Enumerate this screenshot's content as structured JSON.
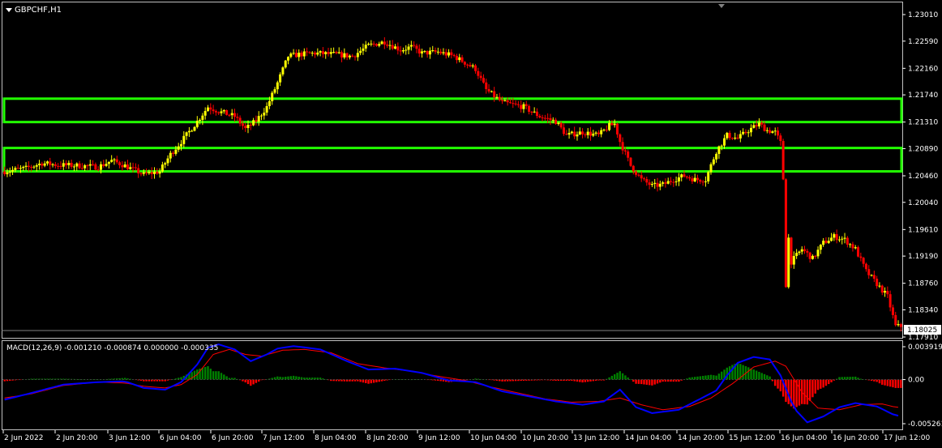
{
  "window": {
    "symbol_title": "GBPCHF,H1",
    "macd_title": "MACD(12,26,9) -0.001210 -0.000874 0.000000 -0.000335"
  },
  "colors": {
    "background": "#000000",
    "axis": "#ffffff",
    "bull_candle": "#ffff00",
    "bear_candle": "#ff0000",
    "zone_border": "#22ff00",
    "macd_line": "#0000ff",
    "signal_line": "#ff0000",
    "hist_positive": "#008000",
    "hist_negative": "#ff0000",
    "price_tag_bg": "#ffffff",
    "price_tag_text": "#000000"
  },
  "chart_data": [
    {
      "type": "candlestick",
      "symbol": "GBPCHF",
      "timeframe": "H1",
      "ylim": [
        1.1791,
        1.2301
      ],
      "y_ticks": [
        "1.23010",
        "1.22590",
        "1.22160",
        "1.21740",
        "1.21310",
        "1.20890",
        "1.20460",
        "1.20040",
        "1.19610",
        "1.19190",
        "1.18760",
        "1.18340",
        "1.17910"
      ],
      "x_ticks": [
        "2 Jun 2022",
        "2 Jun 20:00",
        "3 Jun 12:00",
        "6 Jun 04:00",
        "6 Jun 20:00",
        "7 Jun 12:00",
        "8 Jun 04:00",
        "8 Jun 20:00",
        "9 Jun 12:00",
        "10 Jun 04:00",
        "10 Jun 20:00",
        "13 Jun 12:00",
        "14 Jun 04:00",
        "14 Jun 20:00",
        "15 Jun 12:00",
        "16 Jun 04:00",
        "16 Jun 20:00",
        "17 Jun 12:00"
      ],
      "current_price": "1.18025",
      "zones": [
        {
          "top": 1.2168,
          "bottom": 1.2131
        },
        {
          "top": 1.209,
          "bottom": 1.2053
        }
      ],
      "path": [
        [
          0,
          1.2053
        ],
        [
          8,
          1.2058
        ],
        [
          14,
          1.2066
        ],
        [
          20,
          1.2063
        ],
        [
          28,
          1.2062
        ],
        [
          35,
          1.206
        ],
        [
          40,
          1.207
        ],
        [
          45,
          1.2062
        ],
        [
          52,
          1.2048
        ],
        [
          58,
          1.2053
        ],
        [
          62,
          1.208
        ],
        [
          66,
          1.21
        ],
        [
          72,
          1.2132
        ],
        [
          76,
          1.2155
        ],
        [
          80,
          1.2148
        ],
        [
          86,
          1.214
        ],
        [
          90,
          1.212
        ],
        [
          94,
          1.2133
        ],
        [
          98,
          1.2155
        ],
        [
          102,
          1.2193
        ],
        [
          106,
          1.2235
        ],
        [
          110,
          1.2238
        ],
        [
          116,
          1.224
        ],
        [
          124,
          1.2238
        ],
        [
          130,
          1.2235
        ],
        [
          136,
          1.2252
        ],
        [
          142,
          1.2258
        ],
        [
          148,
          1.2245
        ],
        [
          152,
          1.225
        ],
        [
          156,
          1.224
        ],
        [
          162,
          1.2242
        ],
        [
          168,
          1.2235
        ],
        [
          172,
          1.2225
        ],
        [
          176,
          1.2215
        ],
        [
          180,
          1.2182
        ],
        [
          186,
          1.2162
        ],
        [
          194,
          1.2155
        ],
        [
          200,
          1.214
        ],
        [
          206,
          1.2132
        ],
        [
          210,
          1.211
        ],
        [
          216,
          1.2115
        ],
        [
          222,
          1.211
        ],
        [
          226,
          1.2125
        ],
        [
          228,
          1.2128
        ],
        [
          230,
          1.21
        ],
        [
          234,
          1.2062
        ],
        [
          238,
          1.204
        ],
        [
          242,
          1.203
        ],
        [
          246,
          1.2032
        ],
        [
          250,
          1.204
        ],
        [
          254,
          1.2046
        ],
        [
          258,
          1.204
        ],
        [
          262,
          1.204
        ],
        [
          266,
          1.2085
        ],
        [
          270,
          1.211
        ],
        [
          274,
          1.2105
        ],
        [
          278,
          1.2118
        ],
        [
          282,
          1.2128
        ],
        [
          285,
          1.2118
        ],
        [
          288,
          1.2115
        ],
        [
          290,
          1.2098
        ],
        [
          292,
          1.1985
        ],
        [
          294,
          1.191
        ],
        [
          298,
          1.193
        ],
        [
          302,
          1.1915
        ],
        [
          306,
          1.194
        ],
        [
          310,
          1.195
        ],
        [
          314,
          1.1945
        ],
        [
          318,
          1.193
        ],
        [
          322,
          1.1895
        ],
        [
          326,
          1.1875
        ],
        [
          330,
          1.1855
        ],
        [
          333,
          1.1808
        ]
      ]
    },
    {
      "type": "macd",
      "params": "12,26,9",
      "ylim": [
        -0.005261,
        0.003919
      ],
      "y_ticks": [
        "0.003919",
        "0.00",
        "-0.005261"
      ],
      "macd_path": [
        [
          0,
          -0.0024
        ],
        [
          10,
          -0.0016
        ],
        [
          22,
          -0.0006
        ],
        [
          35,
          -0.0003
        ],
        [
          45,
          -0.0002
        ],
        [
          52,
          -0.001
        ],
        [
          60,
          -0.0012
        ],
        [
          66,
          -0.0003
        ],
        [
          72,
          0.0018
        ],
        [
          76,
          0.0038
        ],
        [
          80,
          0.0042
        ],
        [
          86,
          0.0036
        ],
        [
          92,
          0.0022
        ],
        [
          98,
          0.003
        ],
        [
          102,
          0.0037
        ],
        [
          108,
          0.004
        ],
        [
          118,
          0.0036
        ],
        [
          128,
          0.0022
        ],
        [
          136,
          0.0012
        ],
        [
          146,
          0.0013
        ],
        [
          156,
          0.0008
        ],
        [
          166,
          -0.0001
        ],
        [
          176,
          -0.0003
        ],
        [
          186,
          -0.0014
        ],
        [
          196,
          -0.002
        ],
        [
          206,
          -0.0026
        ],
        [
          216,
          -0.003
        ],
        [
          224,
          -0.0026
        ],
        [
          230,
          -0.0012
        ],
        [
          236,
          -0.0033
        ],
        [
          242,
          -0.004
        ],
        [
          252,
          -0.0036
        ],
        [
          260,
          -0.0023
        ],
        [
          266,
          -0.0013
        ],
        [
          270,
          0.0005
        ],
        [
          274,
          0.002
        ],
        [
          280,
          0.0027
        ],
        [
          286,
          0.0024
        ],
        [
          290,
          0.0005
        ],
        [
          295,
          -0.0034
        ],
        [
          300,
          -0.0051
        ],
        [
          306,
          -0.0044
        ],
        [
          312,
          -0.0033
        ],
        [
          318,
          -0.0028
        ],
        [
          326,
          -0.0032
        ],
        [
          333,
          -0.0043
        ]
      ],
      "signal_path": [
        [
          0,
          -0.0022
        ],
        [
          10,
          -0.0017
        ],
        [
          22,
          -0.0007
        ],
        [
          35,
          -0.0003
        ],
        [
          45,
          -0.0004
        ],
        [
          52,
          -0.0008
        ],
        [
          60,
          -0.001
        ],
        [
          66,
          -0.0006
        ],
        [
          72,
          0.0006
        ],
        [
          78,
          0.003
        ],
        [
          84,
          0.0036
        ],
        [
          90,
          0.003
        ],
        [
          96,
          0.0028
        ],
        [
          104,
          0.0035
        ],
        [
          112,
          0.0036
        ],
        [
          122,
          0.0032
        ],
        [
          132,
          0.0019
        ],
        [
          142,
          0.0014
        ],
        [
          152,
          0.001
        ],
        [
          162,
          0.0004
        ],
        [
          172,
          -0.0001
        ],
        [
          182,
          -0.0009
        ],
        [
          192,
          -0.0016
        ],
        [
          202,
          -0.0023
        ],
        [
          212,
          -0.0027
        ],
        [
          222,
          -0.0026
        ],
        [
          230,
          -0.0022
        ],
        [
          238,
          -0.003
        ],
        [
          246,
          -0.0036
        ],
        [
          256,
          -0.0032
        ],
        [
          264,
          -0.0022
        ],
        [
          272,
          -0.0005
        ],
        [
          280,
          0.0015
        ],
        [
          288,
          0.0022
        ],
        [
          292,
          0.0016
        ],
        [
          298,
          -0.0015
        ],
        [
          304,
          -0.0034
        ],
        [
          312,
          -0.0036
        ],
        [
          320,
          -0.003
        ],
        [
          328,
          -0.0029
        ],
        [
          333,
          -0.0033
        ]
      ]
    }
  ]
}
